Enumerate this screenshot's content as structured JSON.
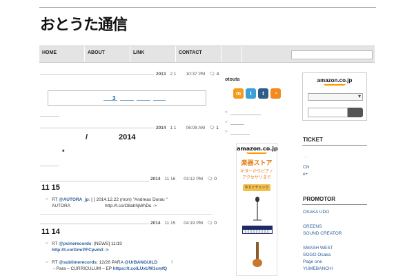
{
  "logo": "おとうた通信",
  "nav": {
    "items": [
      "HOME",
      "ABOUT",
      "LINK",
      "CONTACT"
    ]
  },
  "posts": [
    {
      "year": "2013",
      "date": "2 1",
      "time": "10:37 PM",
      "comments": "4"
    },
    {
      "year": "2014",
      "date": "1 1",
      "time": "06:08 AM",
      "comments": "1",
      "title_left": "/",
      "title_right": "2014",
      "star": "*"
    },
    {
      "year": "2014",
      "date": "11 16",
      "time": "03:12 PM",
      "comments": "0",
      "title": "11 15"
    },
    {
      "year": "2014",
      "date": "11 15",
      "time": "04:19 PM",
      "comments": "0",
      "title": "11 14"
    }
  ],
  "box_number": "3",
  "rt1": {
    "prefix": "RT ",
    "user": "@AUTORA_jp",
    "text": ": [     ] 2014.12.22 (mon) \"Andreas Dorau     \"",
    "line2": "AUTORA",
    "url": "http://t.co/O8ahhjWhDu ->"
  },
  "rt2": {
    "prefix": "RT ",
    "user": "@pvinerecords",
    "text": ": [NEWS] 11/19",
    "url": "http://t.co/GmrPFCpvm3 ->"
  },
  "rt3": {
    "prefix": "RT ",
    "user": "@sublimerecords",
    "text": ": 12/26 PARA ",
    "user2": "@UrBANGUILD",
    "end": "!",
    "line2": "→Para – CURRICULUM – EP ",
    "url": "https://t.co/LUxUW1cmfQ"
  },
  "middle": {
    "heading": "otouta",
    "social": [
      {
        "label": "m",
        "color": "#f39b1c"
      },
      {
        "label": "t",
        "color": "#3aa0d6"
      },
      {
        "label": "t",
        "color": "#2f5d89"
      },
      {
        "label": "r",
        "color": "#f28a1d"
      }
    ],
    "amazon": {
      "brand": "amazon.co.jp",
      "store": "楽器ストア",
      "sub1": "ギターからピアノ",
      "sub2": "アクセサリまで",
      "button": "今すぐチェック"
    }
  },
  "sidebar": {
    "amazon_brand": "amazon.co.jp",
    "ticket_heading": "TICKET",
    "ticket_links": [
      "CN",
      "e+"
    ],
    "promotor_heading": "PROMOTOR",
    "promotor_links": [
      "OSAKA UDO",
      "",
      "GREENS",
      "SOUND CREATOR",
      "",
      "SMASH WEST",
      "SOGO Osaka",
      "Page one",
      "YUMEBANCHI"
    ]
  }
}
